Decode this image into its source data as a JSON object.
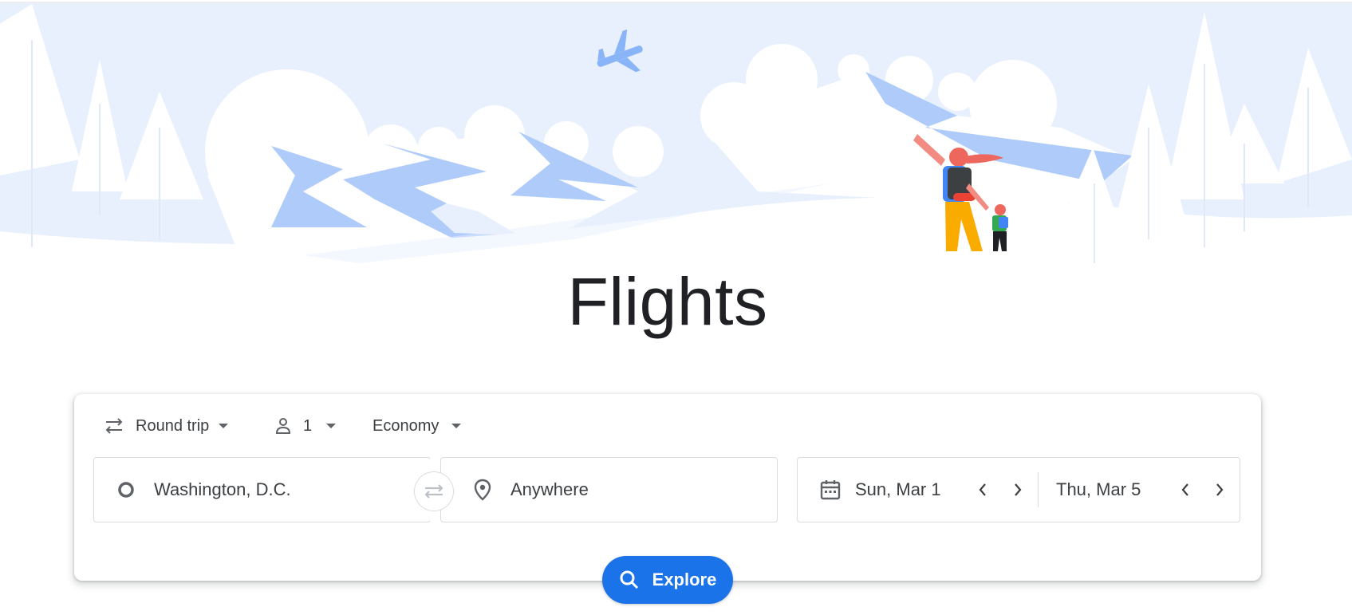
{
  "page": {
    "title": "Flights"
  },
  "trip_options": {
    "trip_type": {
      "label": "Round trip",
      "icon": "round-trip-arrows-icon"
    },
    "passengers": {
      "count": "1",
      "icon": "person-icon"
    },
    "cabin_class": {
      "label": "Economy"
    }
  },
  "search": {
    "origin": {
      "value": "Washington, D.C.",
      "icon": "origin-circle-icon"
    },
    "destination": {
      "value": "Anywhere",
      "icon": "location-pin-icon"
    },
    "departure_date": {
      "value": "Sun, Mar 1",
      "icon": "calendar-icon"
    },
    "return_date": {
      "value": "Thu, Mar 5"
    }
  },
  "explore_button": {
    "label": "Explore",
    "icon": "search-icon"
  },
  "colors": {
    "accent": "#1a73e8",
    "sky": "#e8f0fe",
    "mountain": "#aecbfa",
    "text": "#202124"
  }
}
